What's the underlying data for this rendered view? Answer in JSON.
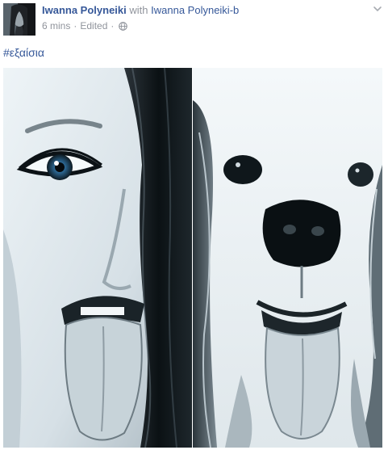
{
  "post": {
    "author_name": "Iwanna Polyneiki",
    "with_text": "with",
    "tagged_name": "Iwanna Polyneiki-b",
    "time": "6 mins",
    "separator": "·",
    "edited_label": "Edited",
    "audience_icon": "globe-icon",
    "caption": "#εξαίσια",
    "menu_icon": "chevron-down-icon",
    "photo_subjects": [
      "woman-face",
      "dog-face"
    ]
  },
  "colors": {
    "link": "#365899",
    "meta": "#90949c"
  }
}
